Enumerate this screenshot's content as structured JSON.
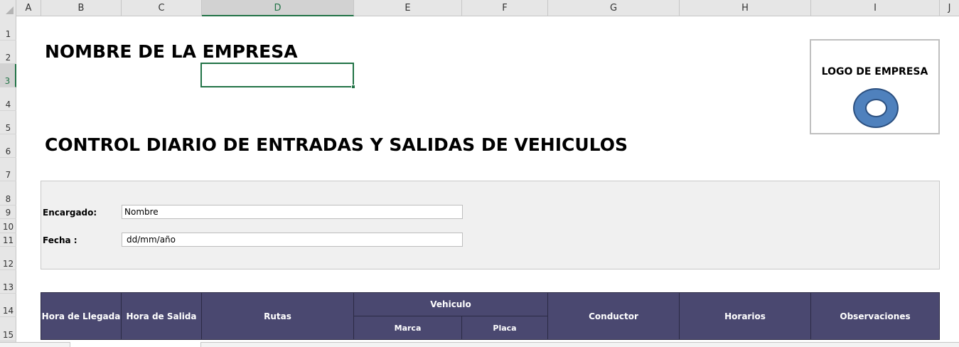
{
  "columns": [
    "A",
    "B",
    "C",
    "D",
    "E",
    "F",
    "G",
    "H",
    "I",
    "J"
  ],
  "rows": [
    "1",
    "2",
    "3",
    "4",
    "5",
    "6",
    "7",
    "8",
    "9",
    "10",
    "11",
    "12",
    "13",
    "14",
    "15"
  ],
  "selected_cell": "D3",
  "company_name": "NOMBRE DE LA EMPRESA",
  "sheet_title": "CONTROL DIARIO DE ENTRADAS Y SALIDAS  DE VEHICULOS",
  "logo": {
    "label": "LOGO DE EMPRESA",
    "icon": "ring-logo-icon",
    "fill_color": "#4f81bd"
  },
  "info": {
    "encargado_label": "Encargado:",
    "encargado_value": "Nombre",
    "fecha_label": "Fecha :",
    "fecha_value": "dd/mm/año"
  },
  "table": {
    "header_color": "#4a4870",
    "headers": {
      "hora_llegada": "Hora de Llegada",
      "hora_salida": "Hora de Salida",
      "rutas": "Rutas",
      "vehiculo": "Vehiculo",
      "marca": "Marca",
      "placa": "Placa",
      "conductor": "Conductor",
      "horarios": "Horarios",
      "observaciones": "Observaciones"
    }
  }
}
